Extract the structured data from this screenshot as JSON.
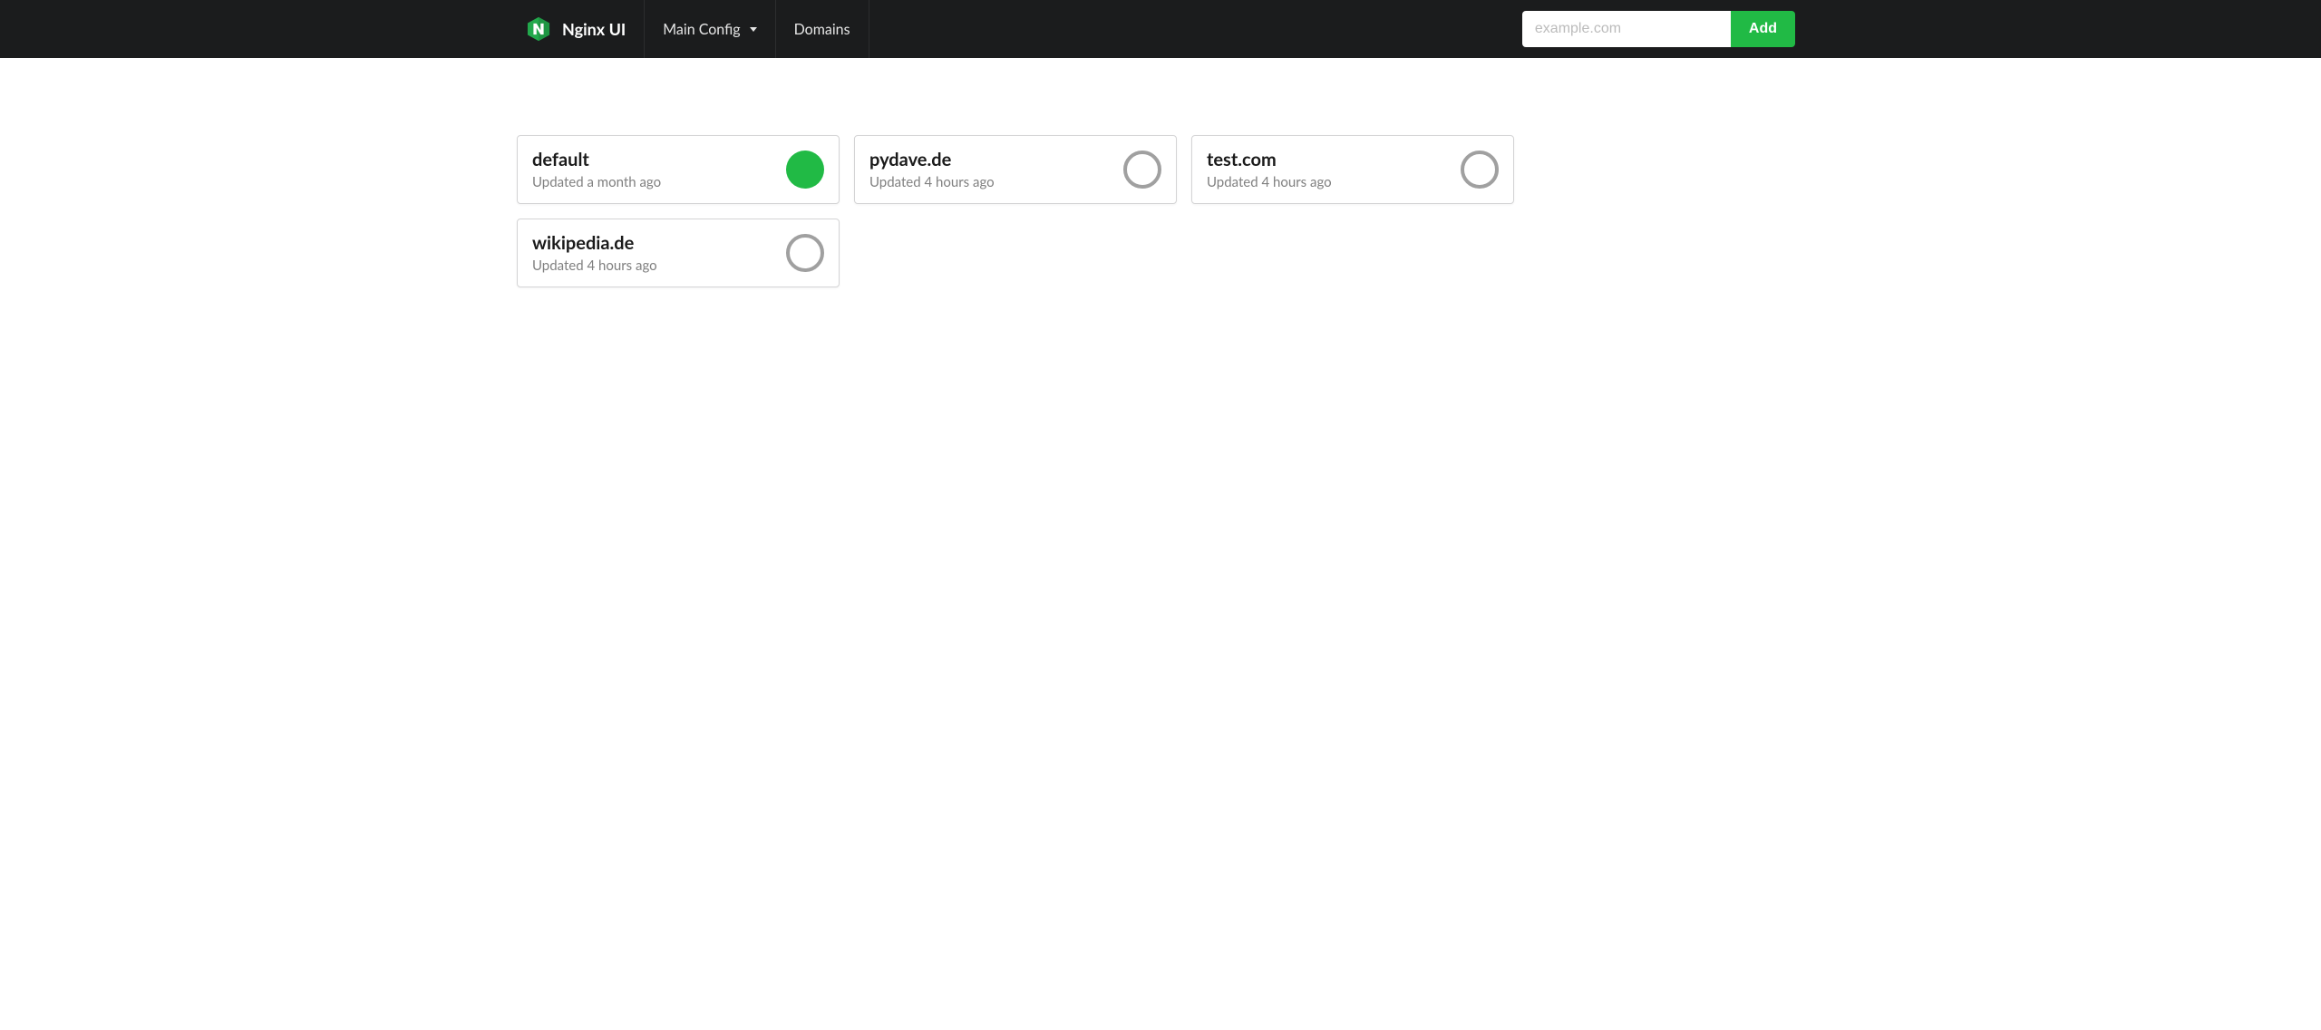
{
  "brand": {
    "title": "Nginx UI"
  },
  "nav": {
    "main_config_label": "Main Config",
    "domains_label": "Domains"
  },
  "add_form": {
    "placeholder": "example.com",
    "button_label": "Add"
  },
  "domains": [
    {
      "name": "default",
      "updated": "Updated a month ago",
      "enabled": true
    },
    {
      "name": "pydave.de",
      "updated": "Updated 4 hours ago",
      "enabled": false
    },
    {
      "name": "test.com",
      "updated": "Updated 4 hours ago",
      "enabled": false
    },
    {
      "name": "wikipedia.de",
      "updated": "Updated 4 hours ago",
      "enabled": false
    }
  ]
}
